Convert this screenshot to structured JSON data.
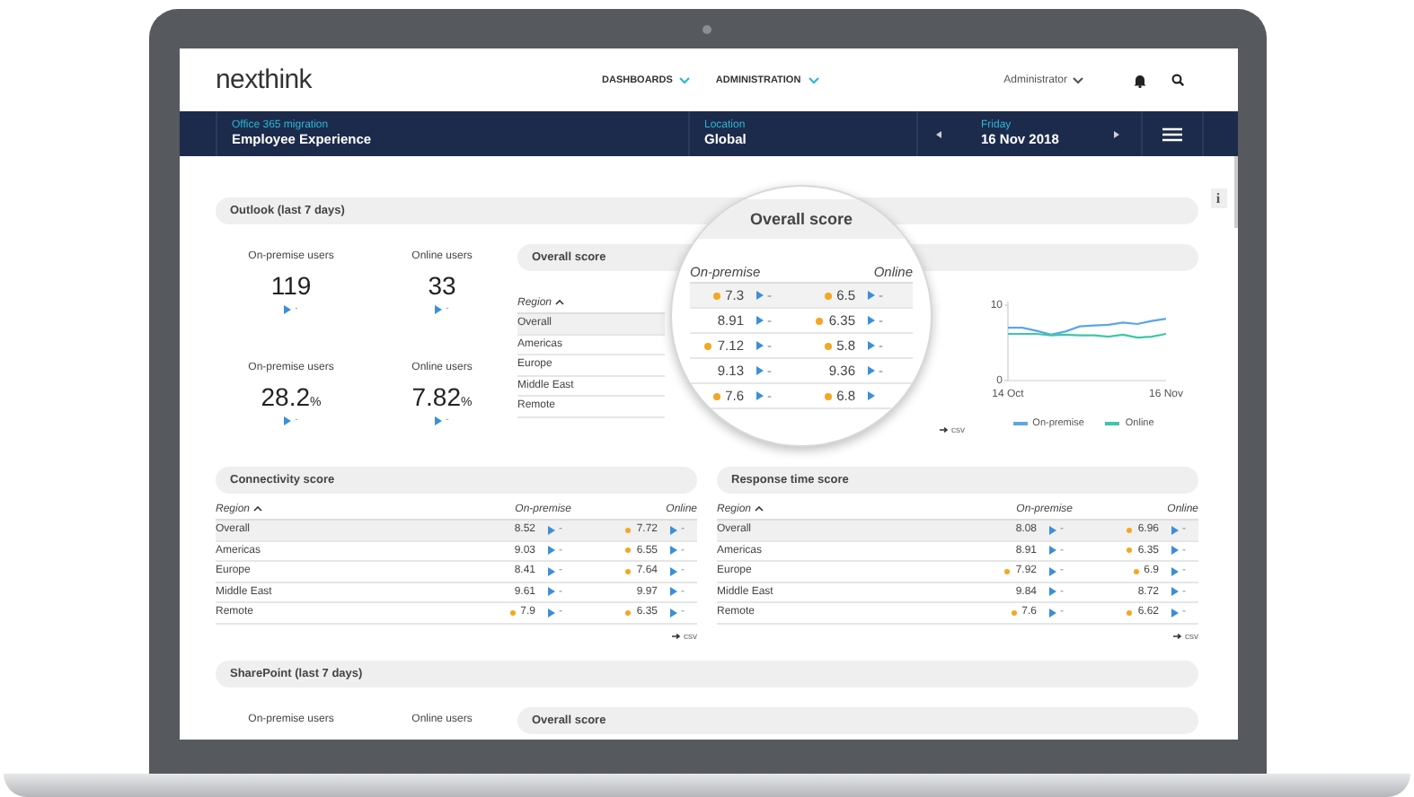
{
  "header": {
    "logo": "nexthink",
    "nav": [
      {
        "label": "DASHBOARDS"
      },
      {
        "label": "ADMINISTRATION"
      }
    ],
    "user": "Administrator"
  },
  "context_bar": {
    "dashboard": {
      "label": "Office 365 migration",
      "value": "Employee Experience"
    },
    "location": {
      "label": "Location",
      "value": "Global"
    },
    "date": {
      "label": "Friday",
      "value": "16 Nov 2018"
    }
  },
  "outlook": {
    "title": "Outlook (last 7 days)",
    "kpis": [
      {
        "label": "On-premise users",
        "value": "119",
        "trend": "-"
      },
      {
        "label": "Online users",
        "value": "33",
        "trend": "-"
      },
      {
        "label": "On-premise users",
        "value": "28.2",
        "unit": "%",
        "trend": "-"
      },
      {
        "label": "Online users",
        "value": "7.82",
        "unit": "%",
        "trend": "-"
      }
    ],
    "overall_score": {
      "title": "Overall score",
      "region_header": "Region",
      "rows": [
        {
          "region": "Overall",
          "selected": true
        },
        {
          "region": "Americas",
          "selected": false
        },
        {
          "region": "Europe",
          "selected": false
        },
        {
          "region": "Middle East",
          "selected": false
        },
        {
          "region": "Remote",
          "selected": false
        }
      ],
      "export": "csv",
      "chart_data": {
        "type": "line",
        "categories": [
          "14 Oct",
          null,
          null,
          null,
          null,
          null,
          null,
          null,
          null,
          null,
          null,
          "16 Nov"
        ],
        "ylim": [
          0,
          10
        ],
        "yticks": [
          0,
          10
        ],
        "series": [
          {
            "name": "On-premise",
            "color": "#5aa7e6",
            "values": [
              7.0,
              7.0,
              6.6,
              6.1,
              6.5,
              7.2,
              7.3,
              7.4,
              7.7,
              7.5,
              7.9,
              8.2
            ]
          },
          {
            "name": "Online",
            "color": "#3cc7a6",
            "values": [
              6.2,
              6.2,
              6.2,
              6.0,
              6.1,
              6.0,
              6.0,
              5.8,
              6.1,
              5.7,
              5.8,
              6.2
            ]
          }
        ],
        "legend": "bottom"
      }
    }
  },
  "magnifier": {
    "title": "Overall score",
    "columns": [
      "On-premise",
      "Online"
    ],
    "rows": [
      {
        "selected": true,
        "cells": [
          {
            "value": "7.3",
            "warning": true,
            "trend": "-"
          },
          {
            "value": "6.5",
            "warning": true,
            "trend": "-"
          }
        ]
      },
      {
        "selected": false,
        "cells": [
          {
            "value": "8.91",
            "warning": false,
            "trend": "-"
          },
          {
            "value": "6.35",
            "warning": true,
            "trend": "-"
          }
        ]
      },
      {
        "selected": false,
        "cells": [
          {
            "value": "7.12",
            "warning": true,
            "trend": "-"
          },
          {
            "value": "5.8",
            "warning": true,
            "trend": "-"
          }
        ]
      },
      {
        "selected": false,
        "cells": [
          {
            "value": "9.13",
            "warning": false,
            "trend": "-"
          },
          {
            "value": "9.36",
            "warning": false,
            "trend": "-"
          }
        ]
      },
      {
        "selected": false,
        "cells": [
          {
            "value": "7.6",
            "warning": true,
            "trend": "-"
          },
          {
            "value": "6.8",
            "warning": true
          }
        ]
      }
    ]
  },
  "info_button": "i",
  "score_tables": [
    {
      "title": "Connectivity score",
      "region_header": "Region",
      "columns": [
        "On-premise",
        "Online"
      ],
      "export": "csv",
      "rows": [
        {
          "region": "Overall",
          "selected": true,
          "cells": [
            {
              "value": "8.52",
              "warning": false,
              "trend": "-"
            },
            {
              "value": "7.72",
              "warning": true,
              "trend": "-"
            }
          ]
        },
        {
          "region": "Americas",
          "selected": false,
          "cells": [
            {
              "value": "9.03",
              "warning": false,
              "trend": "-"
            },
            {
              "value": "6.55",
              "warning": true,
              "trend": "-"
            }
          ]
        },
        {
          "region": "Europe",
          "selected": false,
          "cells": [
            {
              "value": "8.41",
              "warning": false,
              "trend": "-"
            },
            {
              "value": "7.64",
              "warning": true,
              "trend": "-"
            }
          ]
        },
        {
          "region": "Middle East",
          "selected": false,
          "cells": [
            {
              "value": "9.61",
              "warning": false,
              "trend": "-"
            },
            {
              "value": "9.97",
              "warning": false,
              "trend": "-"
            }
          ]
        },
        {
          "region": "Remote",
          "selected": false,
          "cells": [
            {
              "value": "7.9",
              "warning": true,
              "trend": "-"
            },
            {
              "value": "6.35",
              "warning": true,
              "trend": "-"
            }
          ]
        }
      ]
    },
    {
      "title": "Response time score",
      "region_header": "Region",
      "columns": [
        "On-premise",
        "Online"
      ],
      "export": "csv",
      "rows": [
        {
          "region": "Overall",
          "selected": true,
          "cells": [
            {
              "value": "8.08",
              "warning": false,
              "trend": "-"
            },
            {
              "value": "6.96",
              "warning": true,
              "trend": "-"
            }
          ]
        },
        {
          "region": "Americas",
          "selected": false,
          "cells": [
            {
              "value": "8.91",
              "warning": false,
              "trend": "-"
            },
            {
              "value": "6.35",
              "warning": true,
              "trend": "-"
            }
          ]
        },
        {
          "region": "Europe",
          "selected": false,
          "cells": [
            {
              "value": "7.92",
              "warning": true,
              "trend": "-"
            },
            {
              "value": "6.9",
              "warning": true,
              "trend": "-"
            }
          ]
        },
        {
          "region": "Middle East",
          "selected": false,
          "cells": [
            {
              "value": "9.84",
              "warning": false,
              "trend": "-"
            },
            {
              "value": "8.72",
              "warning": false,
              "trend": "-"
            }
          ]
        },
        {
          "region": "Remote",
          "selected": false,
          "cells": [
            {
              "value": "7.6",
              "warning": true,
              "trend": "-"
            },
            {
              "value": "6.62",
              "warning": true,
              "trend": "-"
            }
          ]
        }
      ]
    }
  ],
  "sharepoint": {
    "title": "SharePoint (last 7 days)",
    "kpi_labels": [
      "On-premise users",
      "Online users"
    ],
    "overall_score_title": "Overall score"
  }
}
